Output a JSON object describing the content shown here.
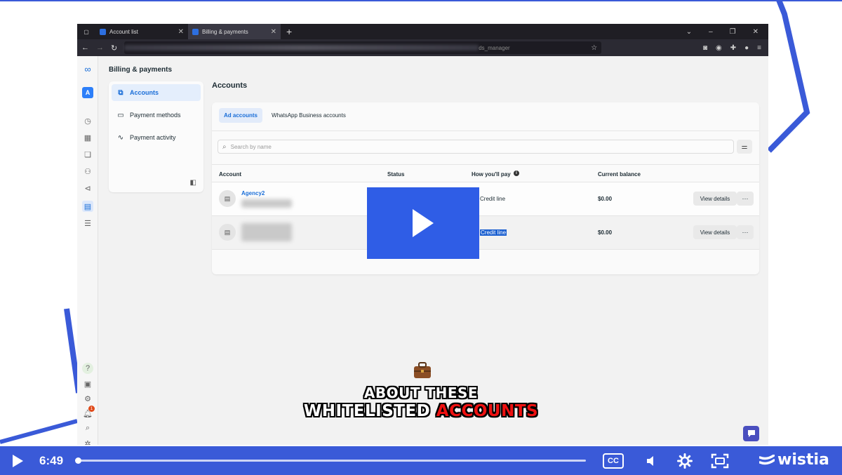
{
  "browser": {
    "tabs": [
      {
        "label": "Account list",
        "active": false
      },
      {
        "label": "Billing & payments",
        "active": true
      }
    ],
    "url_visible": "ds_manager"
  },
  "page": {
    "header": "Billing & payments",
    "rail_avatar": "A",
    "nav": [
      {
        "label": "Accounts",
        "icon": "accounts-icon",
        "active": true
      },
      {
        "label": "Payment methods",
        "icon": "credit-card-icon",
        "active": false
      },
      {
        "label": "Payment activity",
        "icon": "activity-icon",
        "active": false
      }
    ],
    "notification_badge": "1"
  },
  "main": {
    "title": "Accounts",
    "tabs": [
      {
        "label": "Ad accounts",
        "active": true
      },
      {
        "label": "WhatsApp Business accounts",
        "active": false
      }
    ],
    "search_placeholder": "Search by name",
    "columns": [
      "Account",
      "Status",
      "How you'll pay",
      "Current balance"
    ],
    "rows": [
      {
        "name": "Agency2",
        "pay": "Credit line",
        "balance": "$0.00",
        "action": "View details",
        "highlighted": false
      },
      {
        "name": "",
        "pay": "Credit line",
        "balance": "$0.00",
        "action": "View details",
        "highlighted": true
      }
    ],
    "more_label": "···"
  },
  "video": {
    "caption_line1": "ABOUT THESE",
    "caption_line2_a": "WHITELISTED",
    "caption_line2_b": "ACCOUNTS",
    "time": "6:49",
    "cc": "CC",
    "brand": "wistia",
    "progress": 0.0,
    "colors": {
      "player": "#3a5ad8",
      "overlay": "#2f5de6",
      "accent_red": "#ee1111"
    }
  }
}
